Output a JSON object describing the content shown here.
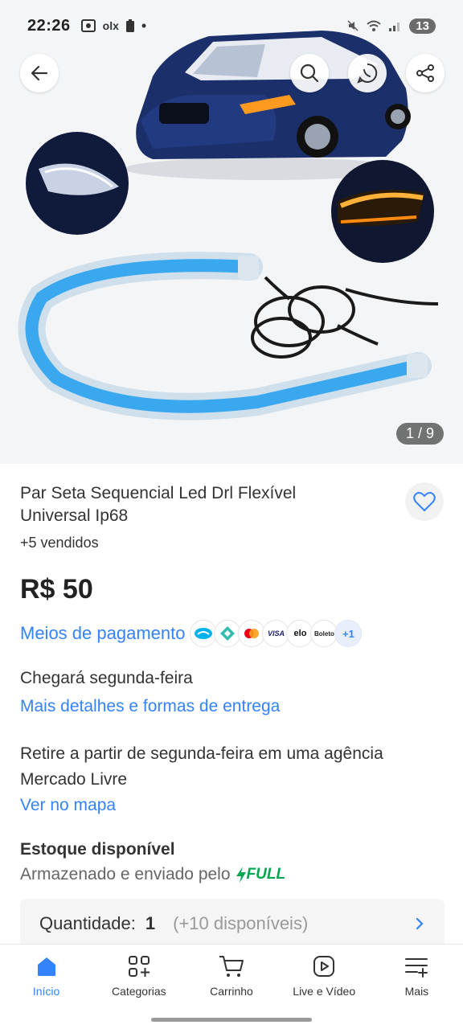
{
  "status_bar": {
    "time": "22:26",
    "left_icons": [
      "screen-record-icon",
      "olx-notification-icon",
      "battery-alert-icon",
      "dot-icon"
    ],
    "olx_text": "olx",
    "battery": "13",
    "right_icons": [
      "mute-icon",
      "wifi-icon",
      "signal-icon"
    ]
  },
  "gallery": {
    "counter": "1 / 9",
    "buttons": [
      "back-icon",
      "search-icon",
      "whatsapp-share-icon",
      "share-icon"
    ]
  },
  "product": {
    "title": "Par Seta Sequencial Led Drl Flexível Universal Ip68",
    "sold": "+5 vendidos",
    "price": "R$ 50"
  },
  "payment": {
    "link": "Meios de pagamento",
    "methods": [
      "Mercado Pago",
      "Pix",
      "Mastercard",
      "VISA",
      "elo",
      "Boleto"
    ],
    "method_labels": [
      "",
      "",
      "",
      "VISA",
      "elo",
      "Boleto"
    ],
    "more": "+1"
  },
  "shipping": {
    "arrive": "Chegará segunda-feira",
    "details_link": "Mais detalhes e formas de entrega"
  },
  "pickup": {
    "text": "Retire a partir de segunda-feira em uma agência Mercado Livre",
    "map_link": "Ver no mapa"
  },
  "stock": {
    "title": "Estoque disponível",
    "subtitle": "Armazenado e enviado pelo",
    "full_label": "FULL"
  },
  "quantity": {
    "label": "Quantidade:",
    "value": "1",
    "available": "(+10 disponíveis)"
  },
  "bottom_nav": {
    "items": [
      {
        "label": "Início",
        "icon": "home-icon",
        "active": true
      },
      {
        "label": "Categorias",
        "icon": "categories-icon",
        "active": false
      },
      {
        "label": "Carrinho",
        "icon": "cart-icon",
        "active": false
      },
      {
        "label": "Live e Vídeo",
        "icon": "play-video-icon",
        "active": false
      },
      {
        "label": "Mais",
        "icon": "menu-plus-icon",
        "active": false
      }
    ]
  },
  "colors": {
    "accent": "#3483fa",
    "full_green": "#00a650",
    "car_blue": "#1b2f6b",
    "led_blue": "#3aa8ee"
  }
}
